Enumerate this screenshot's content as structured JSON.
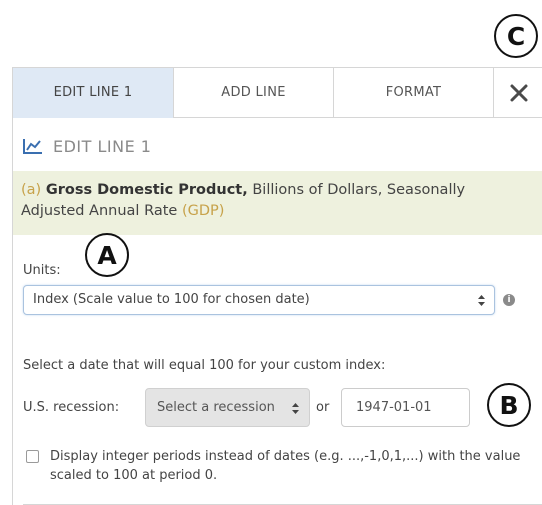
{
  "tabs": [
    {
      "label": "EDIT LINE 1",
      "active": true
    },
    {
      "label": "ADD LINE",
      "active": false
    },
    {
      "label": "FORMAT",
      "active": false
    }
  ],
  "close_icon": "close-x-icon",
  "section": {
    "icon": "line-chart-icon",
    "title": "EDIT LINE 1"
  },
  "series": {
    "letter": "(a)",
    "title": "Gross Domestic Product,",
    "description": "Billions of Dollars, Seasonally Adjusted Annual Rate",
    "code": "(GDP)"
  },
  "units": {
    "label": "Units:",
    "selected": "Index (Scale value to 100 for chosen date)",
    "info_icon": "info-icon"
  },
  "custom_index": {
    "prompt": "Select a date that will equal 100 for your custom index:",
    "recession_label": "U.S. recession:",
    "recession_placeholder": "Select a recession",
    "or_label": "or",
    "date_value": "1947-01-01"
  },
  "integer_periods": {
    "checked": false,
    "label": "Display integer periods instead of dates (e.g. ...,-1,0,1,...) with the value scaled to 100 at period 0."
  },
  "callouts": {
    "a": "A",
    "b": "B",
    "c": "C"
  },
  "colors": {
    "active_tab": "#dfe9f5",
    "series_bg": "#eef1de",
    "series_code": "#c7a24a",
    "link_blue": "#3a6fb0"
  }
}
